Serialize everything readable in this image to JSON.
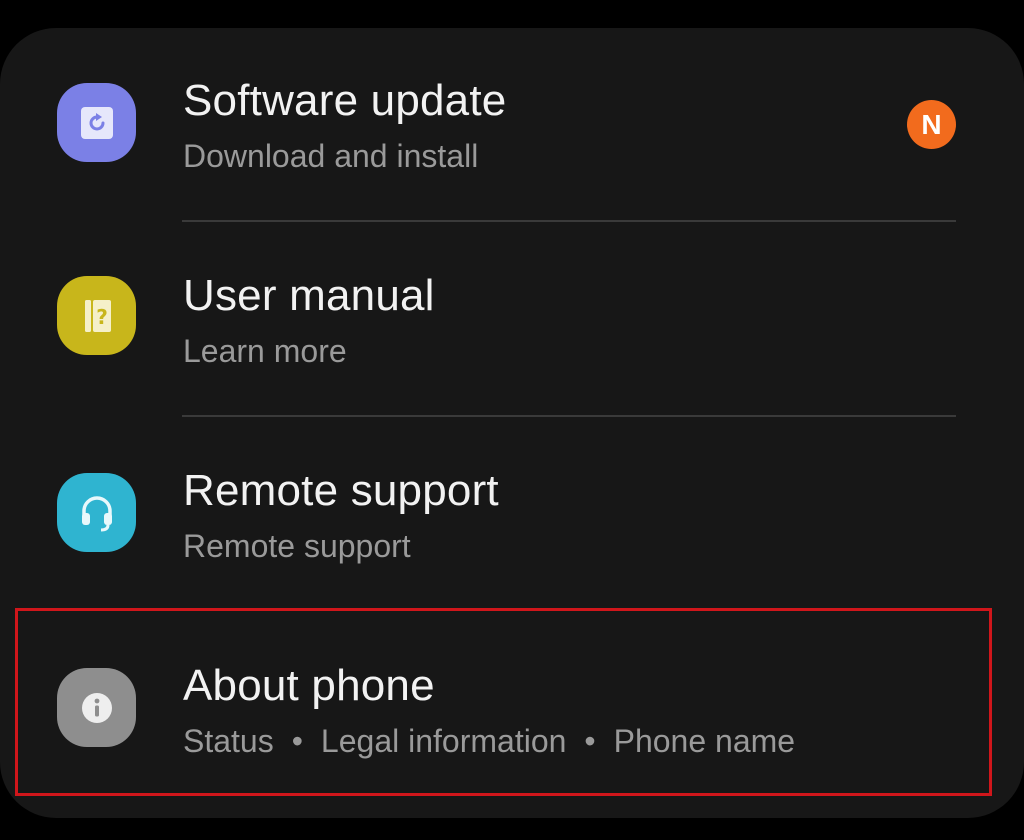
{
  "items": [
    {
      "title": "Software update",
      "subtitle": "Download and install",
      "icon": "software-update-icon",
      "icon_color": "#7b80e6",
      "badge": "N",
      "badge_color": "#f26b1d"
    },
    {
      "title": "User manual",
      "subtitle": "Learn more",
      "icon": "user-manual-icon",
      "icon_color": "#c8b61b"
    },
    {
      "title": "Remote support",
      "subtitle": "Remote support",
      "icon": "headset-icon",
      "icon_color": "#2fb4d0"
    },
    {
      "title": "About phone",
      "subtitle_parts": [
        "Status",
        "Legal information",
        "Phone name"
      ],
      "separator": "•",
      "icon": "info-icon",
      "icon_color": "#8e8e8e",
      "highlight_color": "#d0161b"
    }
  ]
}
